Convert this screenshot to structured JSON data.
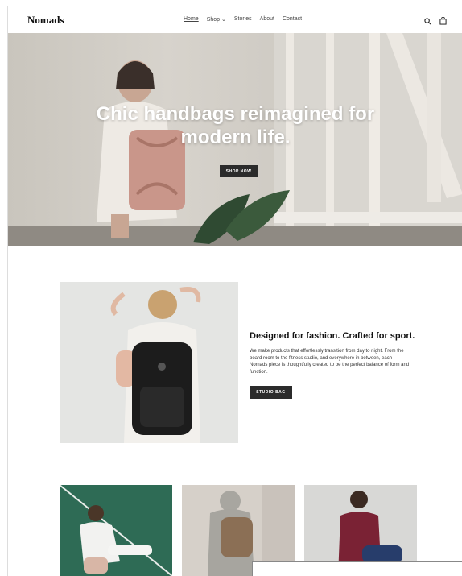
{
  "brand": {
    "logo": "Nomads"
  },
  "nav": {
    "items": [
      {
        "label": "Home",
        "active": true
      },
      {
        "label": "Shop ⌄",
        "active": false
      },
      {
        "label": "Stories",
        "active": false
      },
      {
        "label": "About",
        "active": false
      },
      {
        "label": "Contact",
        "active": false
      }
    ],
    "icons": [
      "search-icon",
      "bag-icon"
    ]
  },
  "hero": {
    "title_line1": "Chic handbags reimagined for",
    "title_line2": "modern life.",
    "button": "SHOP NOW"
  },
  "feature": {
    "title": "Designed for fashion. Crafted for sport.",
    "body": "We make products that effortlessly transition from day to night. From the board room to the fitness studio, and everywhere in between, each Nomads piece is thoughtfully created to be the perfect balance of form and function.",
    "button": "STUDIO BAG"
  },
  "colors": {
    "button_bg": "#2b2b2b",
    "text": "#222222"
  }
}
